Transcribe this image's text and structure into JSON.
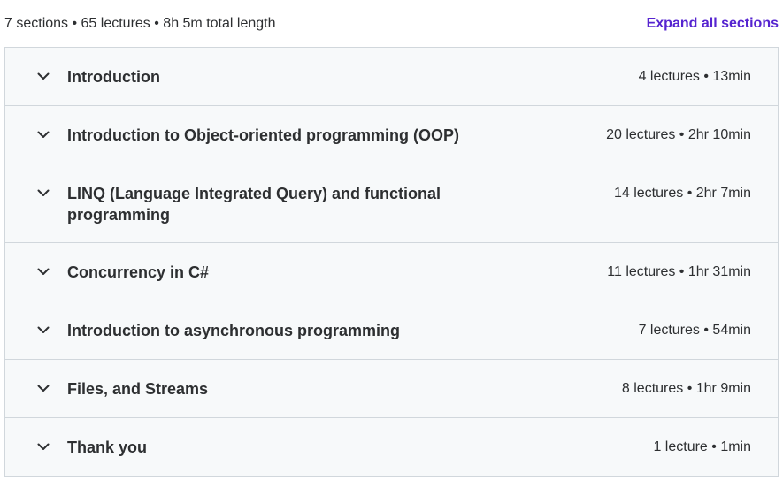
{
  "summary": {
    "text": "7 sections • 65 lectures • 8h 5m total length",
    "expand_label": "Expand all sections"
  },
  "colors": {
    "accent": "#5624d0",
    "section_bg": "#f7f9fa",
    "border": "#d1d7dc",
    "text": "#2d2f31"
  },
  "sections": [
    {
      "title": "Introduction",
      "meta": "4 lectures • 13min",
      "icon": "chevron-down-icon"
    },
    {
      "title": "Introduction to Object-oriented programming (OOP)",
      "meta": "20 lectures • 2hr 10min",
      "icon": "chevron-down-icon"
    },
    {
      "title": "LINQ (Language Integrated Query) and functional programming",
      "meta": "14 lectures • 2hr 7min",
      "icon": "chevron-down-icon"
    },
    {
      "title": "Concurrency in C#",
      "meta": "11 lectures • 1hr 31min",
      "icon": "chevron-down-icon"
    },
    {
      "title": "Introduction to asynchronous programming",
      "meta": "7 lectures • 54min",
      "icon": "chevron-down-icon"
    },
    {
      "title": "Files, and Streams",
      "meta": "8 lectures • 1hr 9min",
      "icon": "chevron-down-icon"
    },
    {
      "title": "Thank you",
      "meta": "1 lecture • 1min",
      "icon": "chevron-down-icon"
    }
  ]
}
